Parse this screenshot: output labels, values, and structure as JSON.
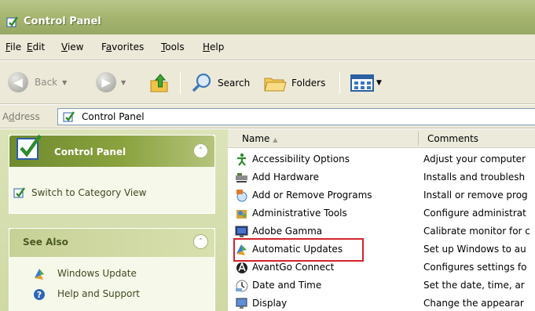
{
  "window": {
    "title": "Control Panel"
  },
  "menu": {
    "items": [
      {
        "label": "File",
        "key": "F",
        "rest": "ile"
      },
      {
        "label": "Edit",
        "key": "E",
        "rest": "dit"
      },
      {
        "label": "View",
        "key": "V",
        "rest": "iew"
      },
      {
        "label": "Favorites",
        "pre": "F",
        "key": "a",
        "rest": "vorites"
      },
      {
        "label": "Tools",
        "key": "T",
        "rest": "ools"
      },
      {
        "label": "Help",
        "key": "H",
        "rest": "elp"
      }
    ]
  },
  "toolbar": {
    "back_label": "Back",
    "search_label": "Search",
    "folders_label": "Folders"
  },
  "address": {
    "label_pre": "A",
    "label_key": "d",
    "label_rest": "dress",
    "value": "Control Panel"
  },
  "left": {
    "control_panel": {
      "title": "Control Panel",
      "link": "Switch to Category View"
    },
    "see_also": {
      "title": "See Also",
      "links": [
        "Windows Update",
        "Help and Support"
      ]
    }
  },
  "list": {
    "columns": {
      "name": "Name",
      "comments": "Comments"
    },
    "rows": [
      {
        "name": "Accessibility Options",
        "comment": "Adjust your computer",
        "icon": "accessibility-icon"
      },
      {
        "name": "Add Hardware",
        "comment": "Installs and troublesh",
        "icon": "hardware-icon"
      },
      {
        "name": "Add or Remove Programs",
        "comment": "Install or remove prog",
        "icon": "programs-icon"
      },
      {
        "name": "Administrative Tools",
        "comment": "Configure administrat",
        "icon": "admin-tools-icon"
      },
      {
        "name": "Adobe Gamma",
        "comment": "Calibrate monitor for c",
        "icon": "adobe-gamma-icon"
      },
      {
        "name": "Automatic Updates",
        "comment": "Set up Windows to au",
        "icon": "automatic-updates-icon",
        "highlighted": true
      },
      {
        "name": "AvantGo Connect",
        "comment": "Configures settings fo",
        "icon": "avantgo-icon"
      },
      {
        "name": "Date and Time",
        "comment": "Set the date, time, ar",
        "icon": "clock-icon"
      },
      {
        "name": "Display",
        "comment": "Change the appearar",
        "icon": "display-icon"
      }
    ]
  }
}
